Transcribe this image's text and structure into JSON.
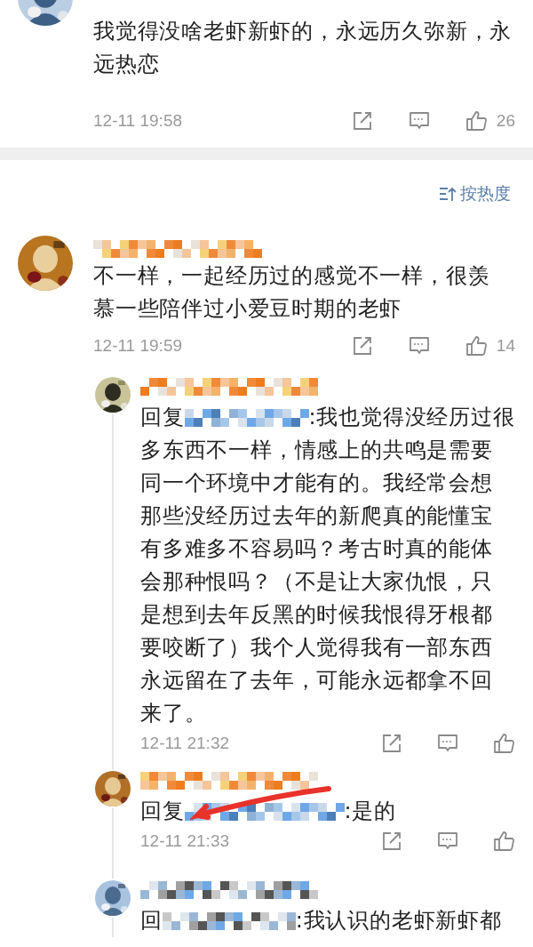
{
  "top_comment": {
    "text_lines": [
      "我觉得没啥老虾新虾的，永远历久弥新，永",
      "远热恋"
    ],
    "time": "12-11 19:58",
    "likes": "26"
  },
  "sort_label": "按热度",
  "comment": {
    "text_lines": [
      "不一样，一起经历过的感觉不一样，很羡",
      "慕一些陪伴过小爱豆时期的老虾"
    ],
    "time": "12-11 19:59",
    "likes": "14",
    "replies": [
      {
        "prefix": "回复",
        "text_lines": [
          ":我也觉得没经历过很",
          "多东西不一样，情感上的共鸣是需要",
          "同一个环境中才能有的。我经常会想",
          "那些没经历过去年的新爬真的能懂宝",
          "有多难多不容易吗？考古时真的能体",
          "会那种恨吗？（不是让大家仇恨，只",
          "是想到去年反黑的时候我恨得牙根都",
          "要咬断了）我个人觉得我有一部东西",
          "永远留在了去年，可能永远都拿不回",
          "来了。"
        ],
        "time": "12-11 21:32",
        "marked": false
      },
      {
        "prefix": "回复",
        "text_lines": [
          ":是的"
        ],
        "time": "12-11 21:33",
        "marked": true
      },
      {
        "prefix": "回",
        "text_lines": [
          ":我认识的老虾新虾都"
        ],
        "marked": false
      }
    ]
  }
}
